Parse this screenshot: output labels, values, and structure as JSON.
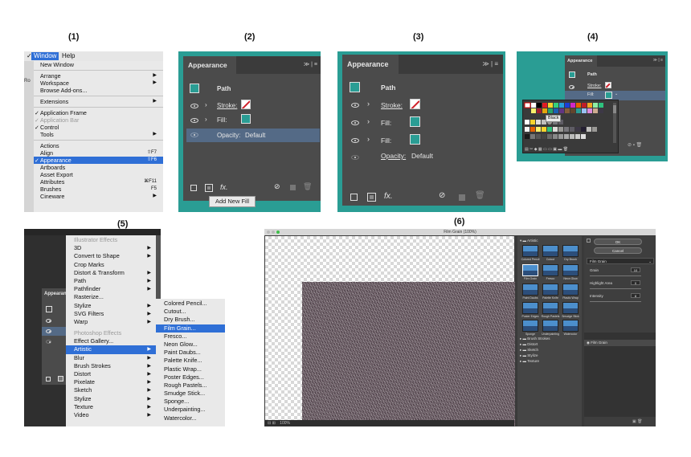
{
  "steps": {
    "s1": "(1)",
    "s2": "(2)",
    "s3": "(3)",
    "s4": "(4)",
    "s5": "(5)",
    "s6": "(6)"
  },
  "panel1": {
    "menubar": {
      "window": "Window",
      "help": "Help",
      "side_fragment": "Ro"
    },
    "menu": [
      "New Window",
      "Arrange",
      "Workspace",
      "Browse Add-ons...",
      "Extensions",
      "Application Frame",
      "Application Bar",
      "Control",
      "Tools",
      "Actions",
      "Align",
      "Appearance",
      "Artboards",
      "Asset Export",
      "Attributes",
      "Brushes",
      "Cineware"
    ],
    "shortcuts": {
      "align": "⇧F7",
      "appearance": "⇧F6",
      "attributes": "⌘F11",
      "brushes": "F5"
    }
  },
  "appearance": {
    "tab": "Appearance",
    "menu_glyph": "≫ | ≡",
    "path": "Path",
    "stroke": "Stroke:",
    "fill": "Fill:",
    "opacity_label": "Opacity:",
    "opacity_value": "Default",
    "fx": "fx.",
    "tooltip": "Add New Fill",
    "teal": "#2a9d94"
  },
  "panel4": {
    "swatch_tooltip": "Black"
  },
  "panel5": {
    "tab_fragment": "Appearan",
    "effects_menu": [
      "Illustrator Effects",
      "3D",
      "Convert to Shape",
      "Crop Marks",
      "Distort & Transform",
      "Path",
      "Pathfinder",
      "Rasterize...",
      "Stylize",
      "SVG Filters",
      "Warp",
      "Photoshop Effects",
      "Effect Gallery...",
      "Artistic",
      "Blur",
      "Brush Strokes",
      "Distort",
      "Pixelate",
      "Sketch",
      "Stylize",
      "Texture",
      "Video"
    ],
    "artistic_submenu": [
      "Colored Pencil...",
      "Cutout...",
      "Dry Brush...",
      "Film Grain...",
      "Fresco...",
      "Neon Glow...",
      "Paint Daubs...",
      "Palette Knife...",
      "Plastic Wrap...",
      "Poster Edges...",
      "Rough Pastels...",
      "Smudge Stick...",
      "Sponge...",
      "Underpainting...",
      "Watercolor..."
    ]
  },
  "panel6": {
    "title": "Film Grain (100%)",
    "zoom": "100%",
    "folders": [
      "Artistic",
      "Brush Strokes",
      "Distort",
      "Sketch",
      "Stylize",
      "Texture"
    ],
    "thumbs": [
      "Colored Pencil",
      "Cutout",
      "Dry Brush",
      "Film Grain",
      "Fresco",
      "Neon Glow",
      "Paint Daubs",
      "Palette Knife",
      "Plastic Wrap",
      "Poster Edges",
      "Rough Pastels",
      "Smudge Stick",
      "Sponge",
      "Underpainting",
      "Watercolor"
    ],
    "ok": "OK",
    "cancel": "Cancel",
    "filter_select": "Film Grain",
    "params": [
      {
        "label": "Grain",
        "value": "10"
      },
      {
        "label": "Highlight Area",
        "value": "0"
      },
      {
        "label": "Intensity",
        "value": "8"
      }
    ],
    "layer": "Film Grain"
  }
}
